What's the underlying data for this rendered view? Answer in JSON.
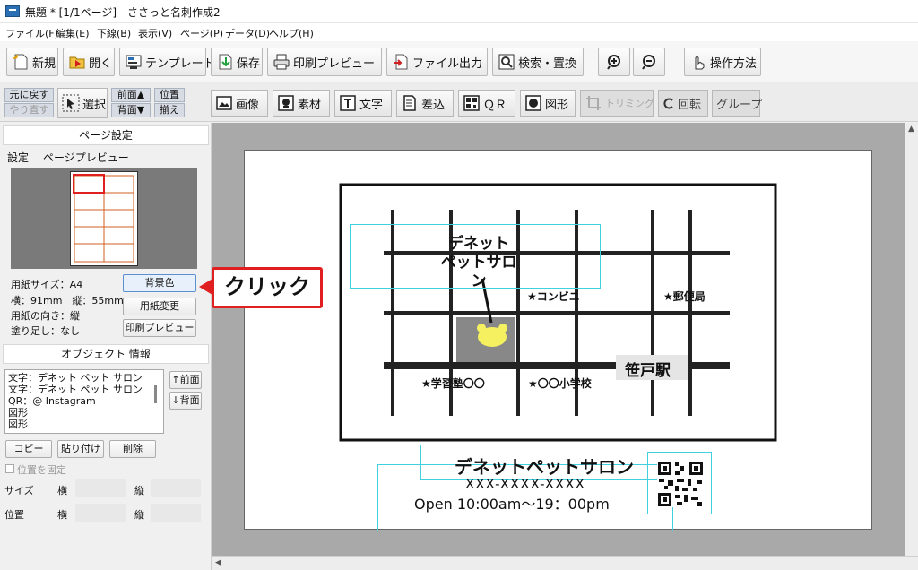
{
  "window": {
    "title": "無題 * [1/1ページ] - ささっと名刺作成2"
  },
  "menu": [
    "ファイル(F)",
    "編集(E)",
    "下线(B)",
    "表示(V)",
    "ページ(P)",
    "データ(D)",
    "ヘルプ(H)"
  ],
  "toolbar1": {
    "new": "新規",
    "open": "開く",
    "template": "テンプレート",
    "save": "保存",
    "print_preview": "印刷プレビュー",
    "file_output": "ファイル出力",
    "search_replace": "検索・置換",
    "help": "操作方法"
  },
  "toolbar2": {
    "undo": "元に戻す",
    "redo": "やり直す",
    "select": "選択",
    "front": "前面▲",
    "back": "背面▼",
    "position": "位置",
    "align": "揃え",
    "image": "画像",
    "material": "素材",
    "text": "文字",
    "merge": "差込",
    "qr": "ＱＲ",
    "shape": "図形",
    "trimming": "トリミング",
    "rotate": "回転",
    "group": "グループ"
  },
  "page_settings": {
    "heading": "ページ設定",
    "tab_settings": "設定",
    "tab_preview": "ページプレビュー",
    "paper_size": "用紙サイズ：A4",
    "dimensions": "横：91mm　縦：55mm",
    "orientation": "用紙の向き：縦",
    "bleed": "塗り足し：なし",
    "bg_color_button": "背景色",
    "change_paper_button": "用紙変更",
    "print_preview_button": "印刷プレビュー"
  },
  "object_info": {
    "heading": "オブジェクト 情報",
    "items": [
      "文字：デネット ペット サロン",
      "文字：デネット ペット サロン",
      "QR：@ Instagram",
      "図形",
      "図形"
    ],
    "front_button": "↑前面",
    "back_button": "↓背面",
    "copy_button": "コピー",
    "paste_button": "貼り付け",
    "delete_button": "削除",
    "lock_position": "位置を固定",
    "size_label": "サイズ",
    "position_label": "位置",
    "width_label": "横",
    "height_label": "縦"
  },
  "callout": {
    "text": "クリック",
    "color": "#e02020"
  },
  "card": {
    "map_name_line1": "デネット",
    "map_name_line2": "ペットサロン",
    "landmark_convenience": "★コンビニ",
    "landmark_post": "★郵便局",
    "landmark_cram": "★学習塾〇〇",
    "landmark_school": "★〇〇小学校",
    "station": "笹戸駅",
    "shop_name": "デネットペットサロン",
    "phone": "XXX-XXXX-XXXX",
    "hours": "Open 10:00am～19：00pm"
  }
}
